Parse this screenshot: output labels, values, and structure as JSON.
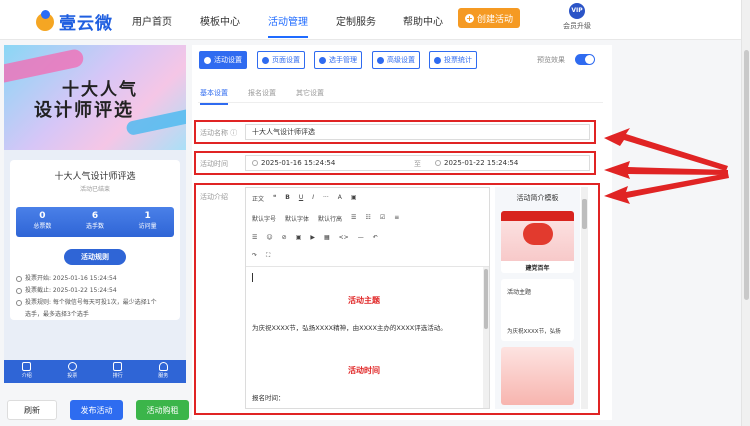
{
  "brand": {
    "name": "壹云微"
  },
  "nav": [
    {
      "label": "用户首页"
    },
    {
      "label": "模板中心"
    },
    {
      "label": "活动管理"
    },
    {
      "label": "定制服务"
    },
    {
      "label": "帮助中心"
    }
  ],
  "header": {
    "create_label": "创建活动",
    "vip_badge": "VIP",
    "vip_label": "会员升级"
  },
  "preview_panel": {
    "banner_line1": "十大人气",
    "banner_line2": "设计师评选",
    "title": "十大人气设计师评选",
    "status": "活动已结束",
    "stats": [
      {
        "num": "0",
        "label": "总票数"
      },
      {
        "num": "6",
        "label": "选手数"
      },
      {
        "num": "1",
        "label": "访问量"
      }
    ],
    "rules_label": "活动规则",
    "rules": [
      "投票开始: 2025-01-16 15:24:54",
      "投票截止: 2025-01-22 15:24:54",
      "投票规则: 每个微信号每天可投1次，最少选择1个",
      "选手，最多选择3个选手"
    ],
    "bottom_nav": [
      "介绍",
      "投票",
      "排行",
      "服务"
    ]
  },
  "actions": {
    "preview": "刷新",
    "publish": "发布活动",
    "buy": "活动购租"
  },
  "tabs": [
    "活动设置",
    "页面设置",
    "选手管理",
    "高级设置",
    "投票统计"
  ],
  "preview_toggle_label": "预览效果",
  "subtabs": [
    "基本设置",
    "报名设置",
    "其它设置"
  ],
  "form": {
    "name_label": "活动名称",
    "name_value": "十大人气设计师评选",
    "time_label": "活动时间",
    "start": "2025-01-16 15:24:54",
    "to": "至",
    "end": "2025-01-22 15:24:54",
    "intro_label": "活动介绍"
  },
  "toolbar": {
    "row1": [
      "正文",
      "❝",
      "B",
      "U",
      "I",
      "···",
      "A",
      "▣"
    ],
    "row2": [
      "默认字号",
      "默认字体",
      "默认行高",
      "☰",
      "☷",
      "☑",
      "≡"
    ],
    "row3": [
      "☰",
      "☺",
      "⊘",
      "▣",
      "▶",
      "▦",
      "<>",
      "—",
      "↶"
    ],
    "row4": [
      "↷",
      "⛶"
    ]
  },
  "editor": {
    "h1": "活动主题",
    "p1": "为庆祝XXXX节，弘扬XXXX精神，由XXXX主办的XXXX评选活动。",
    "h2": "活动时间",
    "p2": "报名时间："
  },
  "templates": {
    "title": "活动简介模板",
    "card1_caption": "建党百年",
    "card2_title": "活动主题",
    "card2_text": "为庆祝XXXX节，弘扬"
  },
  "colors": {
    "accent": "#2f6bf0",
    "highlight": "#e02424",
    "orange": "#f59a23"
  }
}
